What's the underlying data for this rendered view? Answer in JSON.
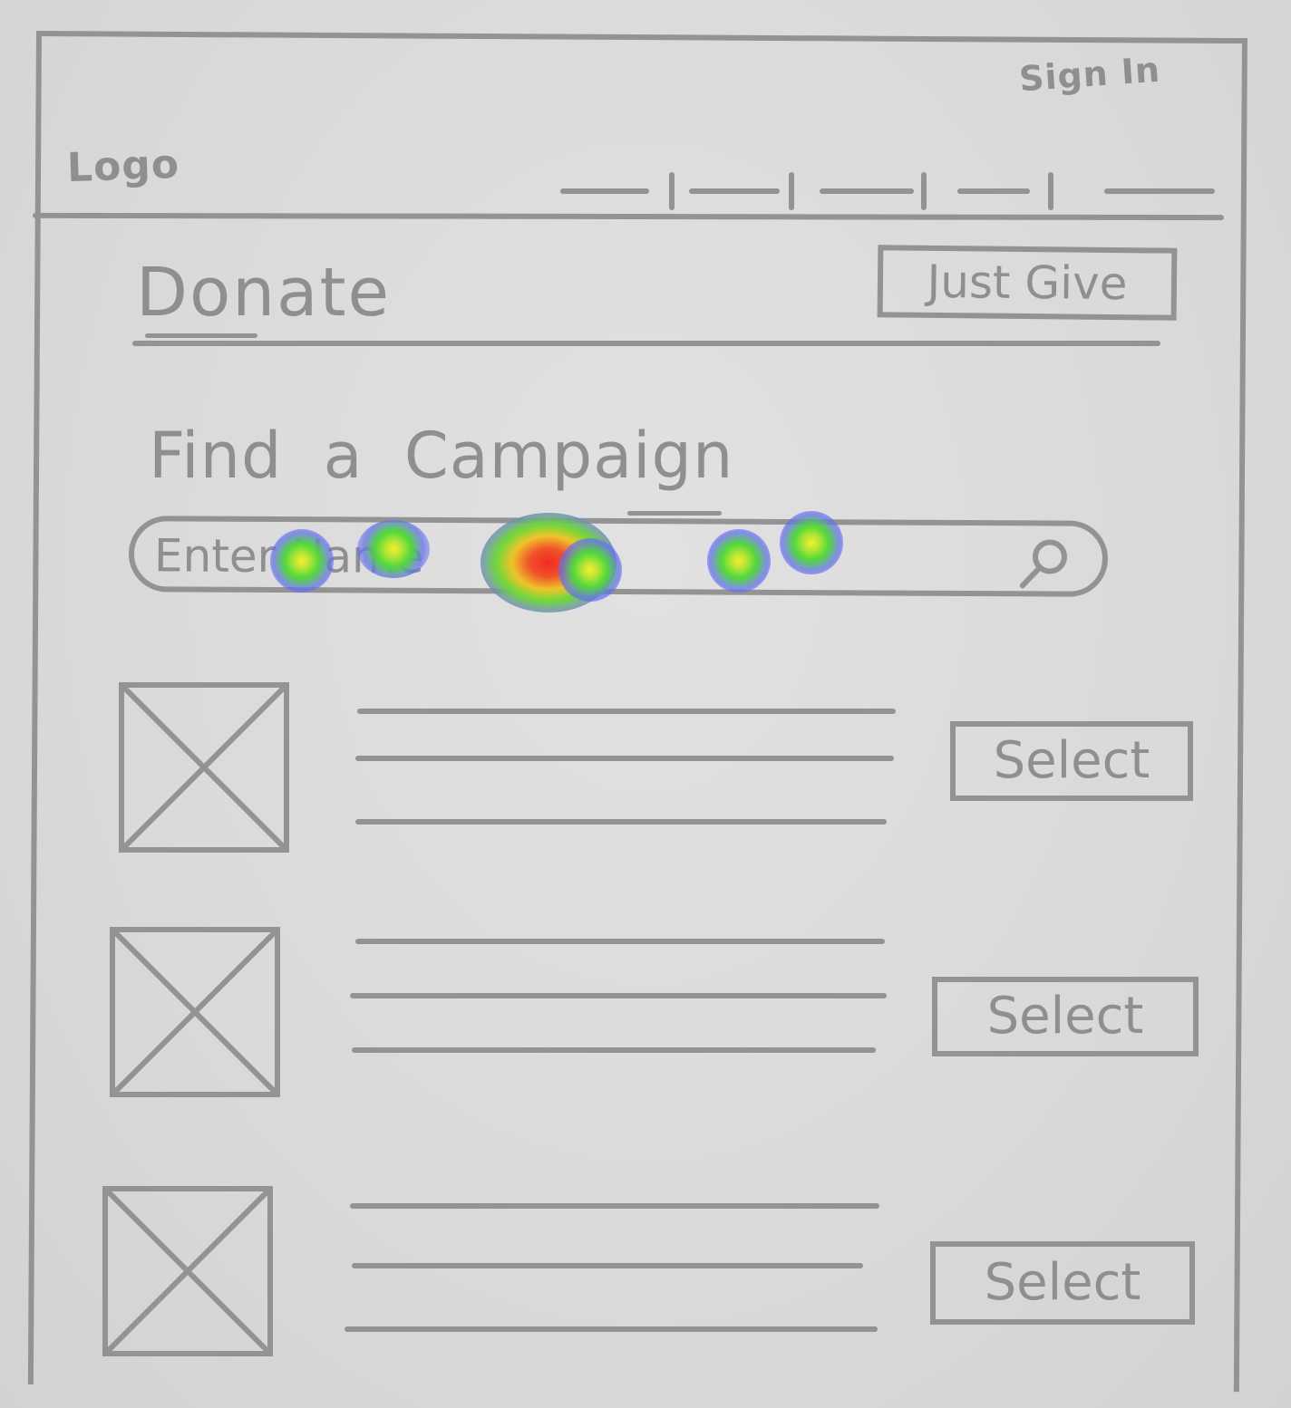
{
  "header": {
    "logo": "Logo",
    "sign_in": "Sign In",
    "nav_items": [
      "",
      "",
      "",
      "",
      ""
    ]
  },
  "donate": {
    "title": "Donate",
    "just_give_label": "Just Give"
  },
  "campaign_search": {
    "title": "Find a Campaign",
    "placeholder": "Enter Name",
    "search_icon": "search-icon"
  },
  "campaign_list": {
    "items": [
      {
        "select_label": "Select"
      },
      {
        "select_label": "Select"
      },
      {
        "select_label": "Select"
      }
    ]
  },
  "heatmap": {
    "colors": [
      "#f02c22",
      "#eec42a",
      "#52d93a",
      "#6a6af0"
    ]
  }
}
